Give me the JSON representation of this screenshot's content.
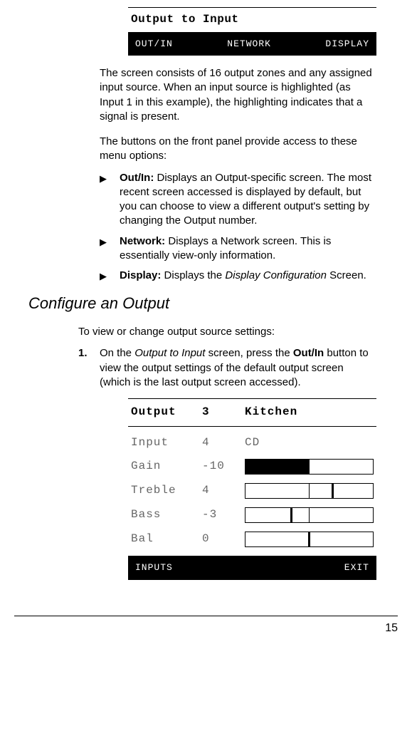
{
  "lcd1": {
    "title": "Output to Input",
    "menu": {
      "left": "OUT/IN",
      "mid": "NETWORK",
      "right": "DISPLAY"
    }
  },
  "para1": "The screen consists of 16 output zones and any assigned input source. When an input source is highlighted (as Input 1 in this example), the highlighting indicates that a signal is present.",
  "para2": "The buttons on the front panel provide access to these menu options:",
  "bullets": {
    "b1_label": "Out/In:",
    "b1_text": " Displays an Output-specific screen. The most recent screen accessed is displayed by default, but you can choose to view a different output's setting by changing the Output number.",
    "b2_label": "Network:",
    "b2_text": " Displays a Network screen. This is essentially view-only information.",
    "b3_label": "Display:",
    "b3_text_a": " Displays the ",
    "b3_text_i": "Display Configuration",
    "b3_text_b": " Screen."
  },
  "section_heading": "Configure an Output",
  "intro": "To view or change output source settings:",
  "step1_num": "1.",
  "step1_a": "On the ",
  "step1_i": "Output to Input",
  "step1_b": " screen, press the ",
  "step1_bold": "Out/In",
  "step1_c": " button to view the output settings of the default output screen (which is the last output screen accessed).",
  "lcd2": {
    "header": {
      "c1": "Output",
      "c2": "3",
      "c3": "Kitchen"
    },
    "row_input": {
      "c1": "Input",
      "c2": "4",
      "c3": "CD"
    },
    "row_gain": {
      "c1": "Gain",
      "c2": "-10"
    },
    "row_treble": {
      "c1": "Treble",
      "c2": "4"
    },
    "row_bass": {
      "c1": "Bass",
      "c2": "-3"
    },
    "row_bal": {
      "c1": "Bal",
      "c2": "0"
    },
    "footer": {
      "left": "INPUTS",
      "right": "EXIT"
    }
  },
  "page_number": "15"
}
